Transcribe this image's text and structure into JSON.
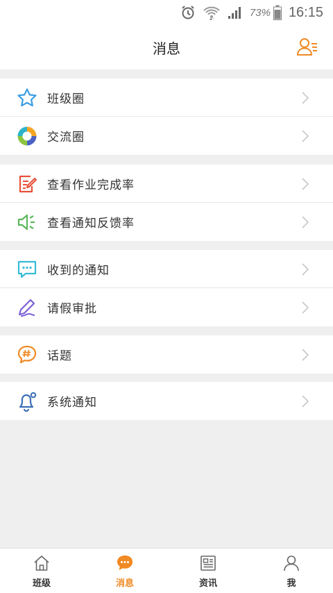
{
  "status_bar": {
    "battery_percent": "73%",
    "time": "16:15"
  },
  "header": {
    "title": "消息",
    "contacts_icon": "contacts-icon",
    "accent": "#f08a24"
  },
  "menu": {
    "items": [
      {
        "label": "班级圈",
        "icon": "star-icon",
        "color": "#3a9ee4"
      },
      {
        "label": "交流圈",
        "icon": "circle-logo-icon",
        "color": "#f5a623"
      },
      {
        "label": "查看作业完成率",
        "icon": "edit-document-icon",
        "color": "#e8503a"
      },
      {
        "label": "查看通知反馈率",
        "icon": "speaker-icon",
        "color": "#5cb85c"
      },
      {
        "label": "收到的通知",
        "icon": "message-bubble-icon",
        "color": "#35bcd6"
      },
      {
        "label": "请假审批",
        "icon": "pen-icon",
        "color": "#7b5fd6"
      },
      {
        "label": "话题",
        "icon": "hashtag-bubble-icon",
        "color": "#f08a24"
      },
      {
        "label": "系统通知",
        "icon": "bell-icon",
        "color": "#3b6fb5"
      }
    ]
  },
  "tabbar": {
    "tabs": [
      {
        "label": "班级",
        "icon": "home-icon",
        "active": false
      },
      {
        "label": "消息",
        "icon": "chat-bubble-icon",
        "active": true
      },
      {
        "label": "资讯",
        "icon": "newspaper-icon",
        "active": false
      },
      {
        "label": "我",
        "icon": "user-icon",
        "active": false
      }
    ],
    "active_color": "#f08a24"
  }
}
